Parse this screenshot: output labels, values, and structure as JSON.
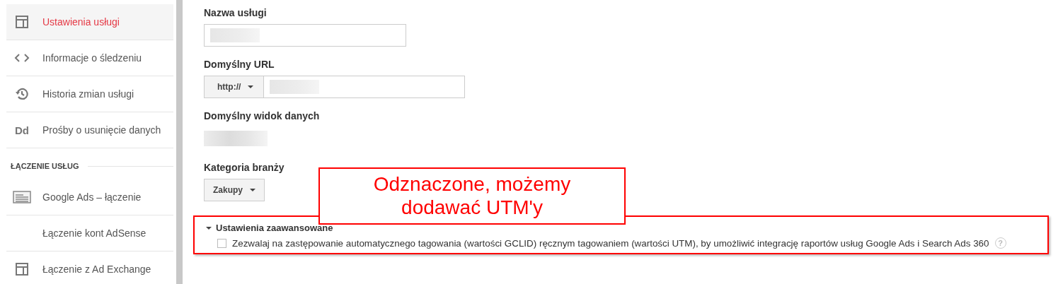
{
  "sidebar": {
    "items": [
      {
        "label": "Ustawienia usługi",
        "kind": "layout",
        "selected": true
      },
      {
        "label": "Informacje o śledzeniu",
        "kind": "code",
        "selected": false
      },
      {
        "label": "Historia zmian usługi",
        "kind": "history",
        "selected": false
      },
      {
        "label": "Prośby o usunięcie danych",
        "kind": "text",
        "icon_text": "Dd",
        "selected": false
      }
    ],
    "section_title": "ŁĄCZENIE USŁUG",
    "section_items": [
      {
        "label": "Google Ads – łączenie",
        "kind": "ads",
        "selected": false
      },
      {
        "label": "Łączenie kont AdSense",
        "kind": "plain",
        "selected": false
      },
      {
        "label": "Łączenie z Ad Exchange",
        "kind": "layout",
        "selected": false
      }
    ]
  },
  "form": {
    "fields": [
      {
        "kind": "text",
        "label": "Nazwa usługi"
      },
      {
        "kind": "url",
        "label": "Domyślny URL",
        "protocol": "http://"
      },
      {
        "kind": "view",
        "label": "Domyślny widok danych"
      },
      {
        "kind": "select",
        "label": "Kategoria branży",
        "value": "Zakupy"
      }
    ],
    "advanced": {
      "title": "Ustawienia zaawansowane",
      "expanded": true,
      "checkbox": {
        "label": "Zezwalaj na zastępowanie automatycznego tagowania (wartości GCLID) ręcznym tagowaniem (wartości UTM), by umożliwić integrację raportów usług Google Ads i Search Ads 360",
        "checked": false
      },
      "help": "?"
    }
  },
  "annotation": {
    "text": "Odznaczone, możemy dodawać UTM'y"
  }
}
